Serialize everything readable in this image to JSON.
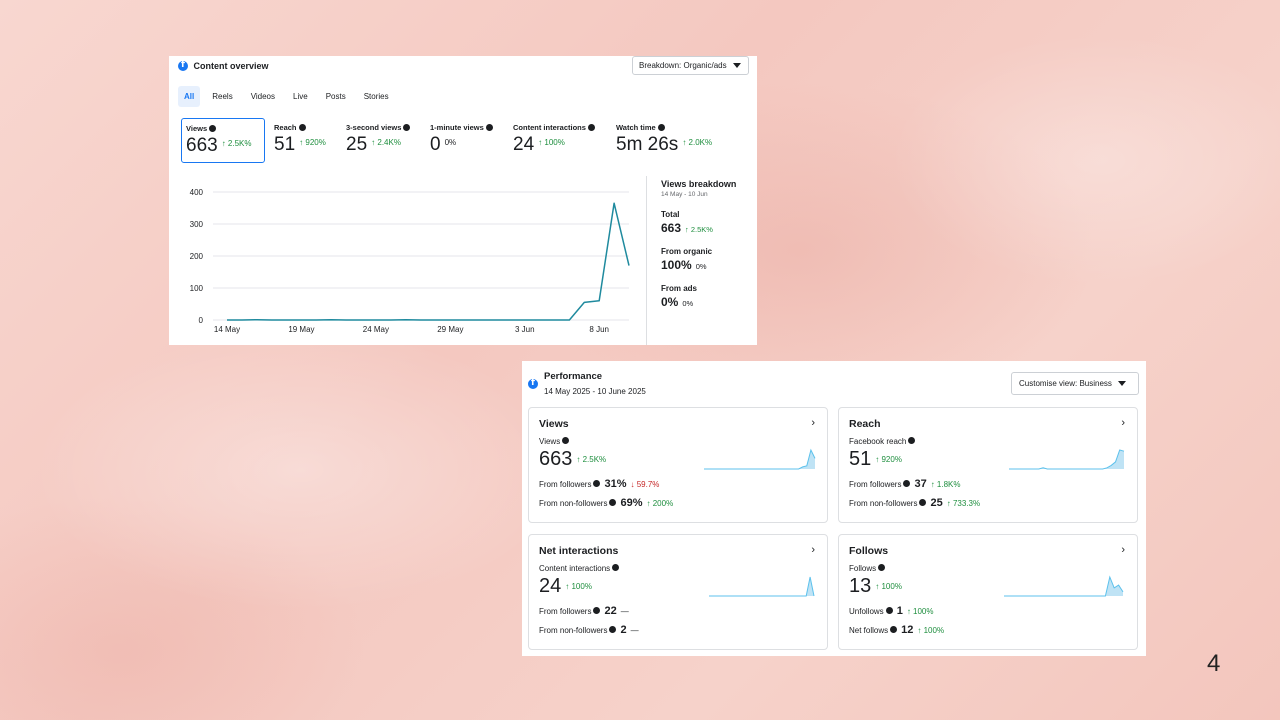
{
  "overview": {
    "title": "Content overview",
    "breakdown_dropdown": "Breakdown: Organic/ads",
    "tabs": [
      {
        "label": "All",
        "active": true
      },
      {
        "label": "Reels",
        "active": false
      },
      {
        "label": "Videos",
        "active": false
      },
      {
        "label": "Live",
        "active": false
      },
      {
        "label": "Posts",
        "active": false
      },
      {
        "label": "Stories",
        "active": false
      }
    ],
    "metrics": [
      {
        "label": "Views",
        "value": "663",
        "change": "↑ 2.5K%",
        "selected": true
      },
      {
        "label": "Reach",
        "value": "51",
        "change": "↑ 920%"
      },
      {
        "label": "3-second views",
        "value": "25",
        "change": "↑ 2.4K%"
      },
      {
        "label": "1-minute views",
        "value": "0",
        "change": "0%"
      },
      {
        "label": "Content interactions",
        "value": "24",
        "change": "↑ 100%"
      },
      {
        "label": "Watch time",
        "value": "5m 26s",
        "change": "↑ 2.0K%"
      }
    ],
    "breakdown": {
      "heading": "Views breakdown",
      "date_range": "14 May - 10 Jun",
      "items": [
        {
          "label": "Total",
          "value": "663",
          "change": "↑ 2.5K%"
        },
        {
          "label": "From organic",
          "value": "100%",
          "change": "0%"
        },
        {
          "label": "From ads",
          "value": "0%",
          "change": "0%"
        }
      ]
    }
  },
  "chart_data": {
    "type": "line",
    "x": [
      "14 May",
      "15 May",
      "16 May",
      "17 May",
      "18 May",
      "19 May",
      "20 May",
      "21 May",
      "22 May",
      "23 May",
      "24 May",
      "25 May",
      "26 May",
      "27 May",
      "28 May",
      "29 May",
      "30 May",
      "31 May",
      "1 Jun",
      "2 Jun",
      "3 Jun",
      "4 Jun",
      "5 Jun",
      "6 Jun",
      "7 Jun",
      "8 Jun",
      "9 Jun",
      "10 Jun"
    ],
    "series": [
      {
        "values": [
          0,
          0,
          1,
          0,
          0,
          0,
          0,
          1,
          0,
          0,
          0,
          0,
          1,
          0,
          0,
          0,
          0,
          0,
          0,
          0,
          0,
          0,
          0,
          0,
          55,
          60,
          365,
          170
        ]
      }
    ],
    "x_tick_labels": [
      "14 May",
      "19 May",
      "24 May",
      "29 May",
      "3 Jun",
      "8 Jun"
    ],
    "y_ticks": [
      0,
      100,
      200,
      300,
      400
    ],
    "ylim": [
      0,
      400
    ],
    "grid": true,
    "color": "#1f8a9e"
  },
  "performance": {
    "title": "Performance",
    "date_range": "14 May 2025 - 10 June 2025",
    "customise_dropdown": "Customise view: Business",
    "cards": [
      {
        "title": "Views",
        "sublabel": "Views",
        "value": "663",
        "change": "↑ 2.5K%",
        "rows": [
          {
            "label": "From followers",
            "value": "31%",
            "change": "↓ 59.7%",
            "dir": "down"
          },
          {
            "label": "From non-followers",
            "value": "69%",
            "change": "↑ 200%",
            "dir": "up"
          }
        ],
        "spark": [
          0,
          0,
          0,
          0,
          0,
          0,
          0,
          0,
          0,
          0,
          0,
          0,
          0,
          0,
          0,
          0,
          0,
          0,
          0,
          0,
          0,
          0,
          0,
          0,
          2,
          3,
          18,
          10
        ]
      },
      {
        "title": "Reach",
        "sublabel": "Facebook reach",
        "value": "51",
        "change": "↑ 920%",
        "rows": [
          {
            "label": "From followers",
            "value": "37",
            "change": "↑ 1.8K%",
            "dir": "up"
          },
          {
            "label": "From non-followers",
            "value": "25",
            "change": "↑ 733.3%",
            "dir": "up"
          }
        ],
        "spark": [
          0,
          0,
          0,
          0,
          0,
          0,
          0,
          0,
          1,
          0,
          0,
          0,
          0,
          0,
          0,
          0,
          0,
          0,
          0,
          0,
          0,
          0,
          0,
          1,
          3,
          6,
          16,
          15
        ]
      },
      {
        "title": "Net interactions",
        "sublabel": "Content interactions",
        "value": "24",
        "change": "↑ 100%",
        "rows": [
          {
            "label": "From followers",
            "value": "22",
            "change": "—",
            "dir": "none"
          },
          {
            "label": "From non-followers",
            "value": "2",
            "change": "—",
            "dir": "none"
          }
        ],
        "spark": [
          0,
          0,
          0,
          0,
          0,
          0,
          0,
          0,
          0,
          0,
          0,
          0,
          0,
          0,
          0,
          0,
          0,
          0,
          0,
          0,
          0,
          0,
          0,
          0,
          0,
          0,
          16,
          0
        ]
      },
      {
        "title": "Follows",
        "sublabel": "Follows",
        "value": "13",
        "change": "↑ 100%",
        "rows": [
          {
            "label": "Unfollows",
            "value": "1",
            "change": "↑ 100%",
            "dir": "up"
          },
          {
            "label": "Net follows",
            "value": "12",
            "change": "↑ 100%",
            "dir": "up"
          }
        ],
        "spark": [
          0,
          0,
          0,
          0,
          0,
          0,
          0,
          0,
          0,
          0,
          0,
          0,
          0,
          0,
          0,
          0,
          0,
          0,
          0,
          0,
          0,
          0,
          0,
          0,
          14,
          6,
          8,
          3
        ]
      }
    ]
  },
  "page_number": "4",
  "colors": {
    "accent": "#1877f2",
    "up": "#1e8e3e",
    "down": "#c62828",
    "line": "#1f8a9e",
    "spark_fill": "#bfe3f5",
    "spark_line": "#5cc1ec"
  }
}
